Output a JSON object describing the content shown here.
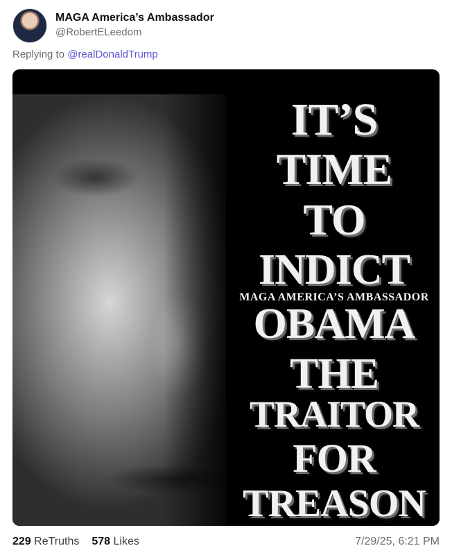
{
  "author": {
    "display_name": "MAGA America’s Ambassador",
    "handle": "@RobertELeedom",
    "avatar_icon": "profile-photo-icon"
  },
  "reply": {
    "prefix": "Replying to",
    "mention": "@realDonaldTrump"
  },
  "image": {
    "headline_lines": [
      "IT’S",
      "TIME",
      "TO",
      "INDICT",
      "OBAMA",
      "THE",
      "TRAITOR",
      "FOR",
      "TREASON"
    ],
    "watermark": "MAGA AMERICA’S AMBASSADOR"
  },
  "stats": {
    "retruths_count": "229",
    "retruths_label": "ReTruths",
    "likes_count": "578",
    "likes_label": "Likes"
  },
  "timestamp": "7/29/25, 6:21 PM",
  "colors": {
    "mention": "#5b55d6",
    "muted": "#6b6b73"
  }
}
